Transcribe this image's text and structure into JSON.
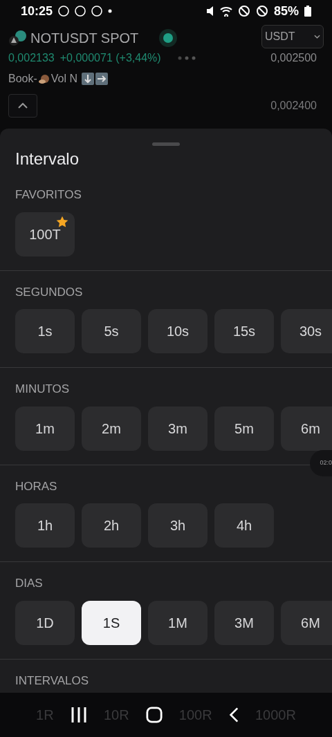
{
  "status_bar": {
    "time": "10:25",
    "battery": "85%"
  },
  "header": {
    "symbol": "NOTUSDT SPOT",
    "live": true,
    "currency": "USDT",
    "price": "0,002133",
    "change": "+0,000071 (+3,44%)",
    "indicator_prefix": "Book-",
    "indicator_suffix": "Vol N",
    "axis_labels": [
      "0,002500",
      "0,002400"
    ]
  },
  "sheet": {
    "title": "Intervalo",
    "sections": [
      {
        "title": "FAVORITOS",
        "options": [
          {
            "label": "100T",
            "selected": false,
            "favorite": true
          }
        ]
      },
      {
        "title": "SEGUNDOS",
        "options": [
          {
            "label": "1s",
            "selected": false,
            "favorite": false
          },
          {
            "label": "5s",
            "selected": false,
            "favorite": false
          },
          {
            "label": "10s",
            "selected": false,
            "favorite": false
          },
          {
            "label": "15s",
            "selected": false,
            "favorite": false
          },
          {
            "label": "30s",
            "selected": false,
            "favorite": false
          }
        ]
      },
      {
        "title": "MINUTOS",
        "options": [
          {
            "label": "1m",
            "selected": false,
            "favorite": false
          },
          {
            "label": "2m",
            "selected": false,
            "favorite": false
          },
          {
            "label": "3m",
            "selected": false,
            "favorite": false
          },
          {
            "label": "5m",
            "selected": false,
            "favorite": false
          },
          {
            "label": "6m",
            "selected": false,
            "favorite": false
          }
        ]
      },
      {
        "title": "HORAS",
        "options": [
          {
            "label": "1h",
            "selected": false,
            "favorite": false
          },
          {
            "label": "2h",
            "selected": false,
            "favorite": false
          },
          {
            "label": "3h",
            "selected": false,
            "favorite": false
          },
          {
            "label": "4h",
            "selected": false,
            "favorite": false
          }
        ]
      },
      {
        "title": "DIAS",
        "options": [
          {
            "label": "1D",
            "selected": false,
            "favorite": false
          },
          {
            "label": "1S",
            "selected": true,
            "favorite": false
          },
          {
            "label": "1M",
            "selected": false,
            "favorite": false
          },
          {
            "label": "3M",
            "selected": false,
            "favorite": false
          },
          {
            "label": "6M",
            "selected": false,
            "favorite": false
          }
        ]
      },
      {
        "title": "INTERVALOS"
      }
    ],
    "time_badge": "02:0",
    "hidden_options": [
      "1R",
      "10R",
      "100R",
      "1000R"
    ]
  }
}
